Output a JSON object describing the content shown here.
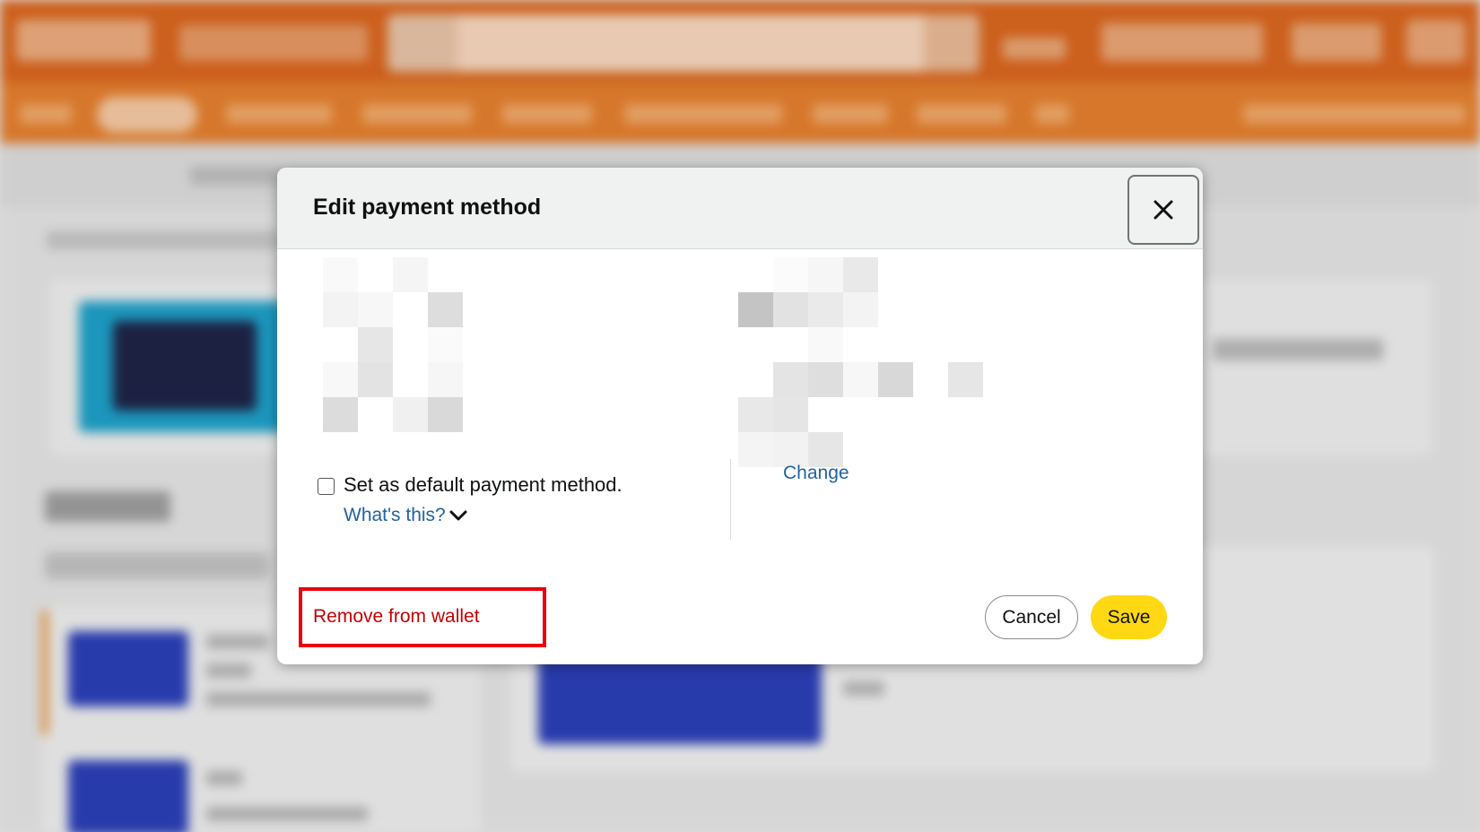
{
  "modal": {
    "title": "Edit payment method",
    "close_icon": "close-icon",
    "default_checkbox_label": "Set as default payment method.",
    "default_checked": false,
    "whats_this_label": "What's this?",
    "whats_this_icon": "chevron-down-icon",
    "change_label": "Change",
    "remove_label": "Remove from wallet",
    "cancel_label": "Cancel",
    "save_label": "Save"
  },
  "colors": {
    "header_bar": "#d9661f",
    "nav_bar": "#e47f2e",
    "link": "#2162a1",
    "remove_text": "#c40000",
    "highlight_border": "#e8000b",
    "save_button": "#ffd814"
  }
}
